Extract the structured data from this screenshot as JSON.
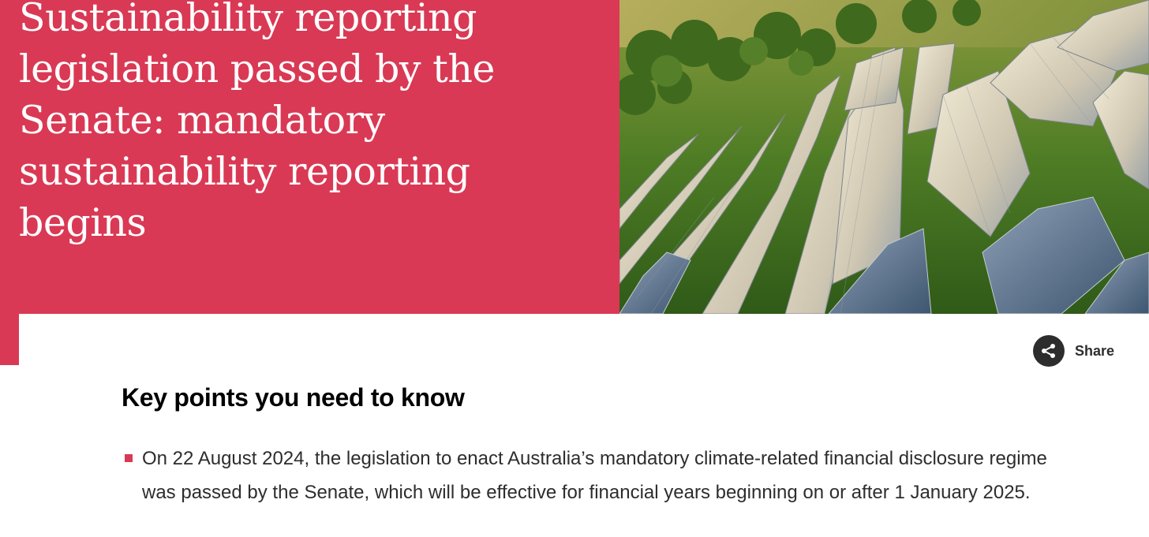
{
  "hero": {
    "title": "Sustainability reporting legislation passed by the Senate: mandatory sustainability reporting begins",
    "image_alt": "Aerial view of solar panel rows on a green hillside",
    "accent_color": "#d93954"
  },
  "share": {
    "label": "Share",
    "icon": "share-icon"
  },
  "key_points": {
    "heading": "Key points you need to know",
    "items": [
      "On 22 August 2024, the legislation to enact Australia’s mandatory climate-related financial disclosure regime was passed by the Senate, which will be effective for financial years beginning on or after 1 January 2025."
    ]
  }
}
